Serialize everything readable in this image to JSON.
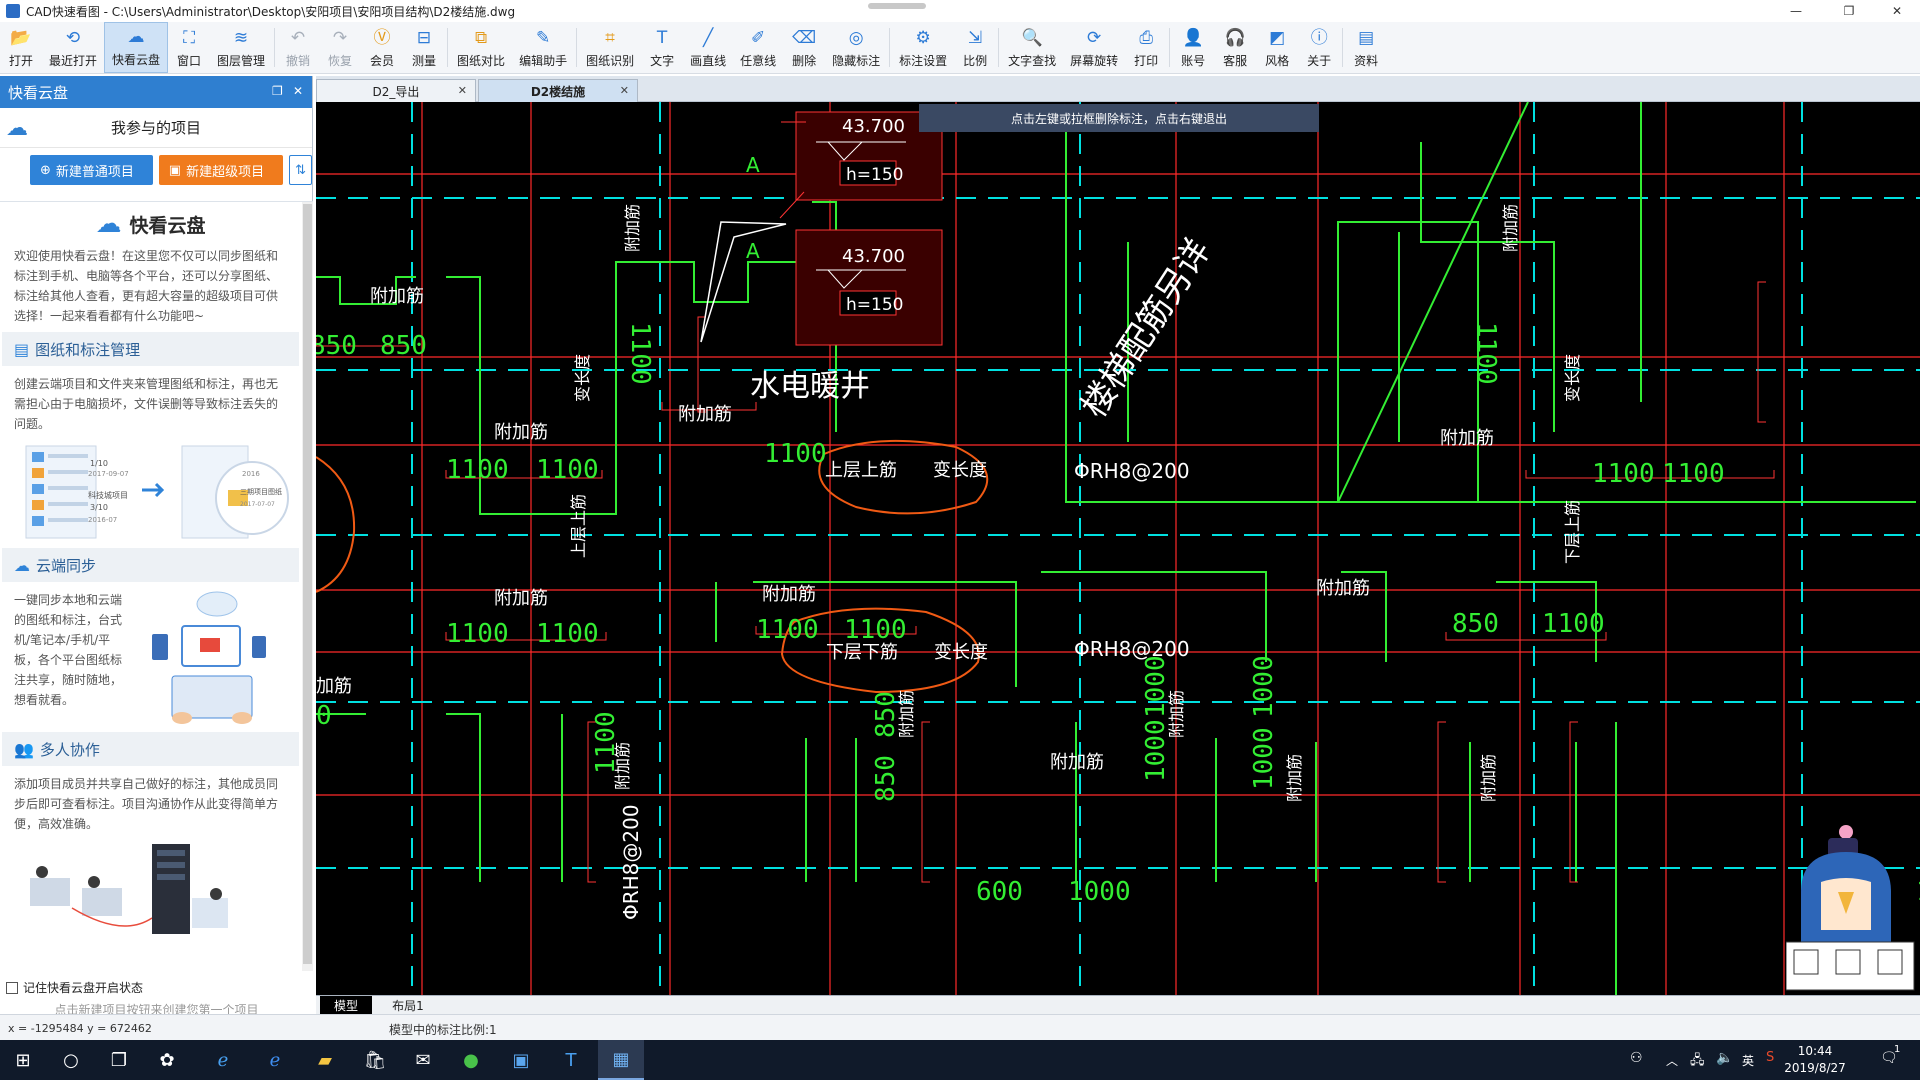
{
  "window": {
    "title": "CAD快速看图 - C:\\Users\\Administrator\\Desktop\\安阳项目\\安阳项目结构\\D2楼结施.dwg",
    "controls": [
      "—",
      "❐",
      "✕"
    ]
  },
  "toolbar": {
    "items": [
      {
        "label": "打开",
        "icon": "folder-open-icon",
        "glyph": "📂"
      },
      {
        "label": "最近打开",
        "icon": "history-icon",
        "glyph": "⟲"
      },
      {
        "label": "快看云盘",
        "icon": "cloud-icon",
        "glyph": "☁",
        "active": true
      },
      {
        "label": "窗口",
        "icon": "window-fit-icon",
        "glyph": "⛶"
      },
      {
        "label": "图层管理",
        "icon": "layers-icon",
        "glyph": "≋"
      },
      {
        "label": "撤销",
        "icon": "undo-icon",
        "glyph": "↶",
        "disabled": true
      },
      {
        "label": "恢复",
        "icon": "redo-icon",
        "glyph": "↷",
        "disabled": true
      },
      {
        "label": "会员",
        "icon": "vip-icon",
        "glyph": "Ⓥ",
        "accent": true
      },
      {
        "label": "测量",
        "icon": "measure-icon",
        "glyph": "⊟"
      },
      {
        "label": "图纸对比",
        "icon": "compare-icon",
        "glyph": "⧉",
        "accent": true
      },
      {
        "label": "编辑助手",
        "icon": "edit-assistant-icon",
        "glyph": "✎"
      },
      {
        "label": "图纸识别",
        "icon": "recognize-icon",
        "glyph": "⌗",
        "accent": true
      },
      {
        "label": "文字",
        "icon": "text-icon",
        "glyph": "T"
      },
      {
        "label": "画直线",
        "icon": "line-icon",
        "glyph": "╱"
      },
      {
        "label": "任意线",
        "icon": "freehand-icon",
        "glyph": "✐"
      },
      {
        "label": "删除",
        "icon": "eraser-icon",
        "glyph": "⌫"
      },
      {
        "label": "隐藏标注",
        "icon": "hide-annotation-icon",
        "glyph": "◎"
      },
      {
        "label": "标注设置",
        "icon": "annotation-settings-icon",
        "glyph": "⚙"
      },
      {
        "label": "比例",
        "icon": "scale-icon",
        "glyph": "⇲"
      },
      {
        "label": "文字查找",
        "icon": "text-search-icon",
        "glyph": "🔍"
      },
      {
        "label": "屏幕旋转",
        "icon": "rotate-screen-icon",
        "glyph": "⟳"
      },
      {
        "label": "打印",
        "icon": "print-icon",
        "glyph": "⎙"
      },
      {
        "label": "账号",
        "icon": "account-icon",
        "glyph": "👤"
      },
      {
        "label": "客服",
        "icon": "headset-icon",
        "glyph": "🎧"
      },
      {
        "label": "风格",
        "icon": "style-icon",
        "glyph": "◩"
      },
      {
        "label": "关于",
        "icon": "info-icon",
        "glyph": "ⓘ"
      },
      {
        "label": "资料",
        "icon": "docs-icon",
        "glyph": "▤"
      }
    ]
  },
  "left_panel": {
    "title": "快看云盘",
    "my_projects": "我参与的项目",
    "btn_new_normal": "新建普通项目",
    "btn_new_super": "新建超级项目",
    "brand": "快看云盘",
    "intro": "欢迎使用快看云盘！在这里您不仅可以同步图纸和标注到手机、电脑等各个平台，还可以分享图纸、标注给其他人查看，更有超大容量的超级项目可供选择！一起来看看都有什么功能吧~",
    "sections": [
      {
        "title": "图纸和标注管理",
        "text": "创建云端项目和文件夹来管理图纸和标注，再也无需担心由于电脑损坏，文件误删等导致标注丢失的问题。"
      },
      {
        "title": "云端同步",
        "text": "一键同步本地和云端的图纸和标注，台式机/笔记本/手机/平板，各个平台图纸标注共享，随时随地，想看就看。"
      },
      {
        "title": "多人协作",
        "text": "添加项目成员并共享自己做好的标注，其他成员同步后即可查看标注。项目沟通协作从此变得简单方便，高效准确。"
      }
    ],
    "illus_card1": {
      "line1": "科技城项目",
      "date1": "2017-09-07",
      "count1": "1/10",
      "count2": "3/10",
      "date2": "2016-07"
    },
    "illus_card2": {
      "title": "三期项目图纸",
      "date": "2017-07-07",
      "year": "2016"
    },
    "remember_label": "记住快看云盘开启状态",
    "footer_hint": "点击新建项目按钮来创建您第一个项目"
  },
  "tabs": [
    {
      "label": "D2_导出",
      "active": false
    },
    {
      "label": "D2楼结施",
      "active": true
    }
  ],
  "canvas": {
    "prompt": "点击左键或拉框删除标注，点击右键退出",
    "texts": {
      "shuidian": "水电暖井",
      "stair": "楼梯配筋另详",
      "elev1": "43.700",
      "elev2": "43.700",
      "h1": "h=150",
      "h2": "h=150",
      "A1": "A",
      "A2": "A",
      "note_upper": "上层上筋　　变长度",
      "note_lower": "下层下筋　　变长度",
      "rh1": "ΦRH8@200",
      "rh2": "ΦRH8@200",
      "rh_v": "ΦRH8@200",
      "fujia": "附加筋",
      "biancd": "变长度",
      "upper_v": "上层上筋",
      "lower_v": "下层上筋",
      "dims": {
        "d850a": "850",
        "d850b": "850",
        "d1100a": "1100",
        "d1100b": "1100",
        "d1100c": "1100",
        "d1100d": "1100",
        "d1100e": "1100",
        "d1100f": "1100",
        "d1100g": "1100",
        "d1100h": "1100",
        "d1100i": "1100",
        "d1100j": "1100",
        "d850c": "850",
        "d1100k": "1100",
        "d1100v1": "1100",
        "d1100v2": "1100",
        "d1100v3": "1100",
        "d850v1": "850",
        "d850v2": "850",
        "d600": "600",
        "d1000a": "1000",
        "d1000v1": "1000",
        "d1000v2": "1000",
        "d1000v3": "1000",
        "d1000v4": "1000",
        "d0": "0",
        "fujia_l": "加筋"
      }
    }
  },
  "model_tabs": [
    {
      "label": "模型",
      "active": true
    },
    {
      "label": "布局1",
      "active": false
    }
  ],
  "status": {
    "coords": "x = -1295484  y = 672462",
    "scale": "模型中的标注比例:1"
  },
  "taskbar": {
    "time": "10:44",
    "date": "2019/8/27",
    "ime": "英",
    "notif_count": "1"
  }
}
